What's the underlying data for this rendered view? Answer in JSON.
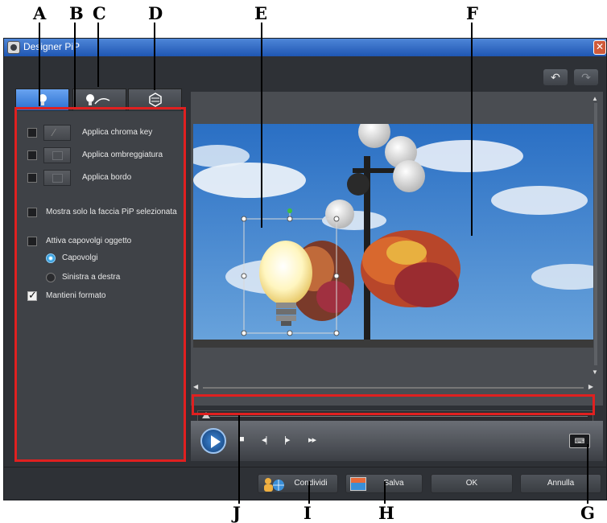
{
  "callouts": [
    "A",
    "B",
    "C",
    "D",
    "E",
    "F",
    "J",
    "I",
    "H",
    "G"
  ],
  "window": {
    "title": "Designer PiP",
    "close_glyph": "✕"
  },
  "toolbar": {
    "undo_icon": "undo-icon",
    "redo_icon": "redo-icon",
    "undo_glyph": "↶",
    "redo_glyph": "↷"
  },
  "tabs": [
    {
      "icon": "lightbulb-icon"
    },
    {
      "icon": "lightbulb-path-icon"
    },
    {
      "icon": "object-icon"
    }
  ],
  "options": {
    "chroma_key": "Applica chroma key",
    "shadow": "Applica ombreggiatura",
    "border": "Applica bordo",
    "only_selected": "Mostra solo la faccia PiP selezionata",
    "flip_object": "Attiva capovolgi oggetto",
    "flip": "Capovolgi",
    "left_right": "Sinistra a destra",
    "keep_format": "Mantieni formato"
  },
  "player": {
    "stop_glyph": "■",
    "prev_glyph": "◂|",
    "next_glyph": "|▸",
    "ff_glyph": "▸▸",
    "keyboard_glyph": "⌨"
  },
  "bottom": {
    "share": "Condividi",
    "save": "Salva",
    "ok": "OK",
    "cancel": "Annulla"
  },
  "colors": {
    "accent": "#2a6fd0",
    "callout_box": "#e02020"
  }
}
